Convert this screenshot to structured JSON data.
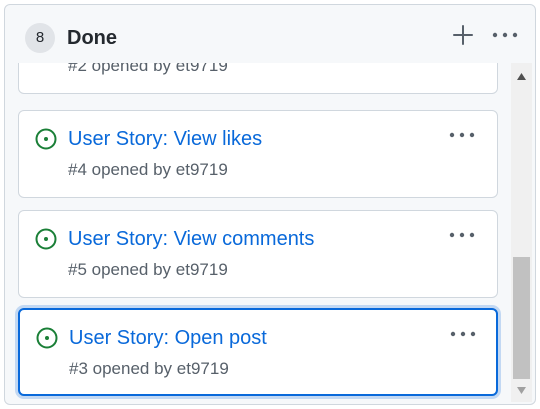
{
  "column": {
    "count": "8",
    "title": "Done",
    "add_icon": "plus-icon",
    "menu_icon": "kebab-horizontal-icon"
  },
  "cards": [
    {
      "title": "",
      "number": "#2",
      "meta_text": " opened by ",
      "author": "et9719",
      "icon": "issue-opened-icon",
      "partial": true
    },
    {
      "title": "User Story: View likes",
      "number": "#4",
      "meta_text": " opened by ",
      "author": "et9719",
      "icon": "issue-opened-icon"
    },
    {
      "title": "User Story: View comments",
      "number": "#5",
      "meta_text": " opened by ",
      "author": "et9719",
      "icon": "issue-opened-icon"
    },
    {
      "title": "User Story: Open post",
      "number": "#3",
      "meta_text": " opened by ",
      "author": "et9719",
      "icon": "issue-opened-icon",
      "selected": true
    }
  ],
  "colors": {
    "link": "#0969da",
    "open_issue": "#1a7f37",
    "muted": "#57606a",
    "selection": "#0969da"
  }
}
